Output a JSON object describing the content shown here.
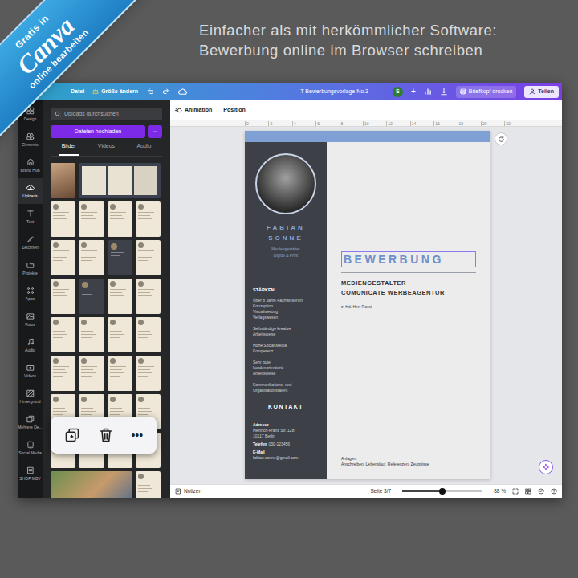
{
  "banner": {
    "top": "Gratis in",
    "logo": "Canva",
    "bottom": "online bearbeiten"
  },
  "headline": [
    "Einfacher als mit herkömmlicher Software:",
    "Bewerbung online im Browser schreiben"
  ],
  "editor": {
    "menu": [
      "Datei",
      "Größe ändern"
    ],
    "title": "T-Bewerbungsvorlage No.3",
    "avatar": "S",
    "add": "+",
    "print_button": "Briefkopf drucken",
    "share_button": "Teilen"
  },
  "rail": [
    {
      "label": "Design",
      "selected": false
    },
    {
      "label": "Elemente",
      "selected": false
    },
    {
      "label": "Brand Hub",
      "selected": false
    },
    {
      "label": "Uploads",
      "selected": true
    },
    {
      "label": "Text",
      "selected": false
    },
    {
      "label": "Zeichnen",
      "selected": false
    },
    {
      "label": "Projekte",
      "selected": false
    },
    {
      "label": "Apps",
      "selected": false
    },
    {
      "label": "Fotos",
      "selected": false
    },
    {
      "label": "Audio",
      "selected": false
    },
    {
      "label": "Videos",
      "selected": false
    },
    {
      "label": "Hintergrund",
      "selected": false
    },
    {
      "label": "Mehrere De...",
      "selected": false
    },
    {
      "label": "Social Media",
      "selected": false
    },
    {
      "label": "SHOP MBV",
      "selected": false
    }
  ],
  "panel": {
    "search": {
      "placeholder": "Uploads durchsuchen"
    },
    "upload_button": "Dateien hochladen",
    "more": "•••",
    "tabs": [
      {
        "label": "Bilder",
        "selected": true
      },
      {
        "label": "Videos",
        "selected": false
      },
      {
        "label": "Audio",
        "selected": false
      }
    ],
    "thumbnails": [
      {
        "kind": "photo"
      },
      {
        "kind": "screen-wide"
      },
      {
        "kind": "doc"
      },
      {
        "kind": "doc"
      },
      {
        "kind": "doc"
      },
      {
        "kind": "doc"
      },
      {
        "kind": "doc"
      },
      {
        "kind": "doc"
      },
      {
        "kind": "dark"
      },
      {
        "kind": "doc"
      },
      {
        "kind": "doc"
      },
      {
        "kind": "dark"
      },
      {
        "kind": "doc"
      },
      {
        "kind": "doc"
      },
      {
        "kind": "doc"
      },
      {
        "kind": "doc"
      },
      {
        "kind": "doc"
      },
      {
        "kind": "doc"
      },
      {
        "kind": "doc"
      },
      {
        "kind": "doc"
      },
      {
        "kind": "doc"
      },
      {
        "kind": "doc"
      },
      {
        "kind": "doc"
      },
      {
        "kind": "doc"
      },
      {
        "kind": "doc"
      },
      {
        "kind": "doc"
      },
      {
        "kind": "doc"
      },
      {
        "kind": "doc"
      },
      {
        "kind": "doc"
      },
      {
        "kind": "doc"
      },
      {
        "kind": "photo-wide"
      },
      {
        "kind": "doc"
      }
    ],
    "popup": {
      "more": "•••"
    }
  },
  "toolbar": [
    "Animation",
    "Position"
  ],
  "ruler": [
    "0",
    "2",
    "4",
    "6",
    "8",
    "10",
    "12",
    "14",
    "16",
    "18",
    "20",
    "22"
  ],
  "document": {
    "name": [
      "FABIAN",
      "SONNE"
    ],
    "role": [
      "Mediengestalter",
      "Digital & Print"
    ],
    "strengths_title": "STÄRKEN:",
    "strengths": [
      [
        "Über 8 Jahre Fachwissen in",
        "Konzeption",
        "Visualisierung",
        "Verlagswesen"
      ],
      [
        "Selbständige kreative",
        "Arbeitsweise"
      ],
      [
        "Hohe Social Media",
        "Kompetenz"
      ],
      [
        "Sehr gute",
        "kundenorientierte",
        "Arbeitsweise"
      ],
      [
        "Kommunikations- und",
        "Organisationstalent"
      ]
    ],
    "contact_title": "KONTAKT",
    "contact": {
      "address_label": "Adresse",
      "address": [
        "Heinrich-Franz Str. 128",
        "10117 Berlin"
      ],
      "phone_label": "Telefon",
      "phone": "030-123456",
      "email_label": "E-Mail",
      "email": "fabian.sonne@gmail.com"
    },
    "heading": {
      "text": "BEWERBUNG",
      "selected": true
    },
    "recipient": [
      "MEDIENGESTALTER",
      "COMUNICATE WERBEAGENTUR"
    ],
    "attention": "z. Hd. Herr Rossi",
    "attachments_label": "Anlagen:",
    "attachments": "Anschreiben, Lebenslauf, Referenzen, Zeugnisse"
  },
  "status_bar": {
    "notes": "Notizen",
    "page": "Seite 3/7",
    "zoom": {
      "level": 0.5,
      "reading": "88 %"
    }
  }
}
